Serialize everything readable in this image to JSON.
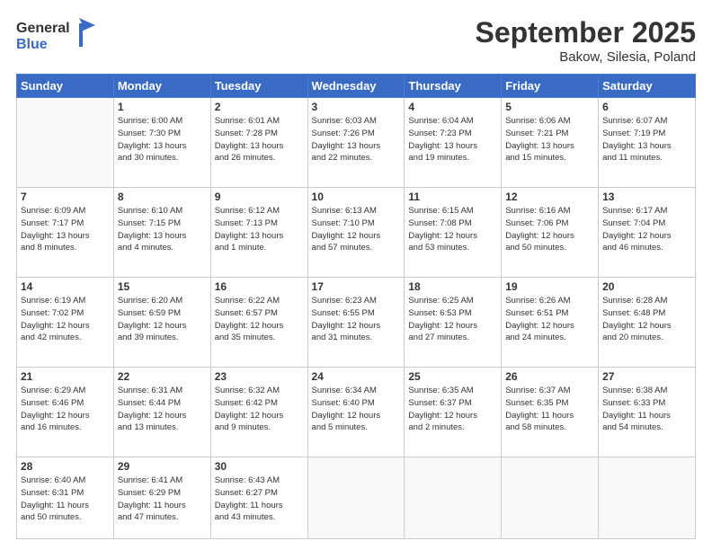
{
  "header": {
    "logo_general": "General",
    "logo_blue": "Blue",
    "month_title": "September 2025",
    "location": "Bakow, Silesia, Poland"
  },
  "weekdays": [
    "Sunday",
    "Monday",
    "Tuesday",
    "Wednesday",
    "Thursday",
    "Friday",
    "Saturday"
  ],
  "weeks": [
    [
      {
        "day": "",
        "info": ""
      },
      {
        "day": "1",
        "info": "Sunrise: 6:00 AM\nSunset: 7:30 PM\nDaylight: 13 hours\nand 30 minutes."
      },
      {
        "day": "2",
        "info": "Sunrise: 6:01 AM\nSunset: 7:28 PM\nDaylight: 13 hours\nand 26 minutes."
      },
      {
        "day": "3",
        "info": "Sunrise: 6:03 AM\nSunset: 7:26 PM\nDaylight: 13 hours\nand 22 minutes."
      },
      {
        "day": "4",
        "info": "Sunrise: 6:04 AM\nSunset: 7:23 PM\nDaylight: 13 hours\nand 19 minutes."
      },
      {
        "day": "5",
        "info": "Sunrise: 6:06 AM\nSunset: 7:21 PM\nDaylight: 13 hours\nand 15 minutes."
      },
      {
        "day": "6",
        "info": "Sunrise: 6:07 AM\nSunset: 7:19 PM\nDaylight: 13 hours\nand 11 minutes."
      }
    ],
    [
      {
        "day": "7",
        "info": "Sunrise: 6:09 AM\nSunset: 7:17 PM\nDaylight: 13 hours\nand 8 minutes."
      },
      {
        "day": "8",
        "info": "Sunrise: 6:10 AM\nSunset: 7:15 PM\nDaylight: 13 hours\nand 4 minutes."
      },
      {
        "day": "9",
        "info": "Sunrise: 6:12 AM\nSunset: 7:13 PM\nDaylight: 13 hours\nand 1 minute."
      },
      {
        "day": "10",
        "info": "Sunrise: 6:13 AM\nSunset: 7:10 PM\nDaylight: 12 hours\nand 57 minutes."
      },
      {
        "day": "11",
        "info": "Sunrise: 6:15 AM\nSunset: 7:08 PM\nDaylight: 12 hours\nand 53 minutes."
      },
      {
        "day": "12",
        "info": "Sunrise: 6:16 AM\nSunset: 7:06 PM\nDaylight: 12 hours\nand 50 minutes."
      },
      {
        "day": "13",
        "info": "Sunrise: 6:17 AM\nSunset: 7:04 PM\nDaylight: 12 hours\nand 46 minutes."
      }
    ],
    [
      {
        "day": "14",
        "info": "Sunrise: 6:19 AM\nSunset: 7:02 PM\nDaylight: 12 hours\nand 42 minutes."
      },
      {
        "day": "15",
        "info": "Sunrise: 6:20 AM\nSunset: 6:59 PM\nDaylight: 12 hours\nand 39 minutes."
      },
      {
        "day": "16",
        "info": "Sunrise: 6:22 AM\nSunset: 6:57 PM\nDaylight: 12 hours\nand 35 minutes."
      },
      {
        "day": "17",
        "info": "Sunrise: 6:23 AM\nSunset: 6:55 PM\nDaylight: 12 hours\nand 31 minutes."
      },
      {
        "day": "18",
        "info": "Sunrise: 6:25 AM\nSunset: 6:53 PM\nDaylight: 12 hours\nand 27 minutes."
      },
      {
        "day": "19",
        "info": "Sunrise: 6:26 AM\nSunset: 6:51 PM\nDaylight: 12 hours\nand 24 minutes."
      },
      {
        "day": "20",
        "info": "Sunrise: 6:28 AM\nSunset: 6:48 PM\nDaylight: 12 hours\nand 20 minutes."
      }
    ],
    [
      {
        "day": "21",
        "info": "Sunrise: 6:29 AM\nSunset: 6:46 PM\nDaylight: 12 hours\nand 16 minutes."
      },
      {
        "day": "22",
        "info": "Sunrise: 6:31 AM\nSunset: 6:44 PM\nDaylight: 12 hours\nand 13 minutes."
      },
      {
        "day": "23",
        "info": "Sunrise: 6:32 AM\nSunset: 6:42 PM\nDaylight: 12 hours\nand 9 minutes."
      },
      {
        "day": "24",
        "info": "Sunrise: 6:34 AM\nSunset: 6:40 PM\nDaylight: 12 hours\nand 5 minutes."
      },
      {
        "day": "25",
        "info": "Sunrise: 6:35 AM\nSunset: 6:37 PM\nDaylight: 12 hours\nand 2 minutes."
      },
      {
        "day": "26",
        "info": "Sunrise: 6:37 AM\nSunset: 6:35 PM\nDaylight: 11 hours\nand 58 minutes."
      },
      {
        "day": "27",
        "info": "Sunrise: 6:38 AM\nSunset: 6:33 PM\nDaylight: 11 hours\nand 54 minutes."
      }
    ],
    [
      {
        "day": "28",
        "info": "Sunrise: 6:40 AM\nSunset: 6:31 PM\nDaylight: 11 hours\nand 50 minutes."
      },
      {
        "day": "29",
        "info": "Sunrise: 6:41 AM\nSunset: 6:29 PM\nDaylight: 11 hours\nand 47 minutes."
      },
      {
        "day": "30",
        "info": "Sunrise: 6:43 AM\nSunset: 6:27 PM\nDaylight: 11 hours\nand 43 minutes."
      },
      {
        "day": "",
        "info": ""
      },
      {
        "day": "",
        "info": ""
      },
      {
        "day": "",
        "info": ""
      },
      {
        "day": "",
        "info": ""
      }
    ]
  ]
}
